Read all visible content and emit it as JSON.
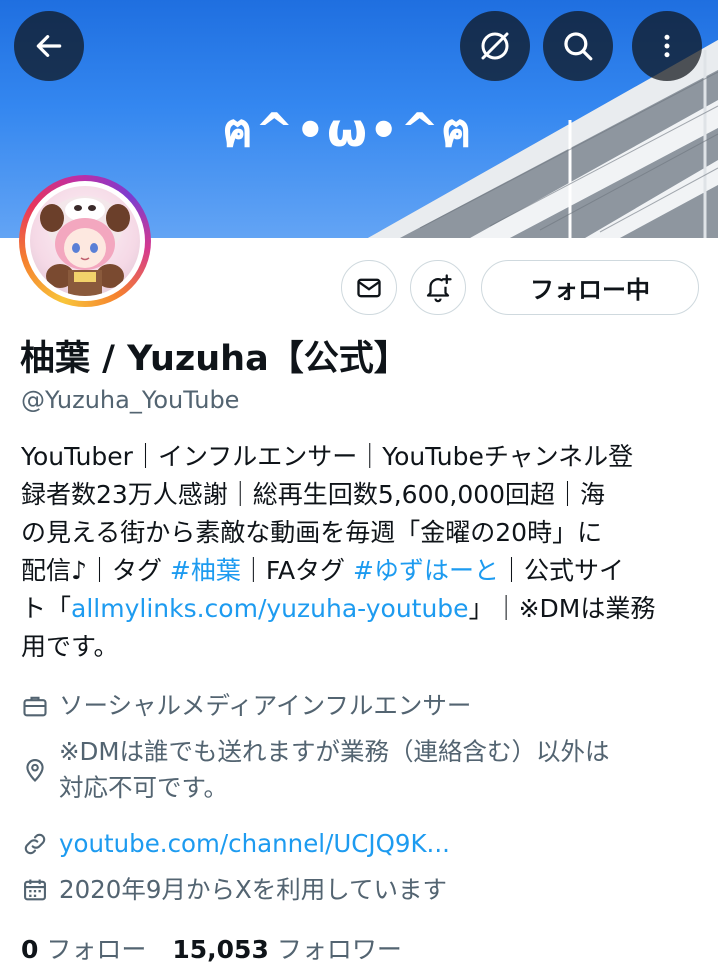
{
  "banner": {
    "text": "ฅ^•ω•^ฅ"
  },
  "header_buttons": {
    "back": "arrow-left-icon",
    "nosignal": "slash-circle-icon",
    "search": "search-icon",
    "more": "more-vertical-icon"
  },
  "actions": {
    "follow_label": "フォロー中"
  },
  "profile": {
    "display_name": "柚葉 / Yuzuha【公式】",
    "handle": "@Yuzuha_YouTube",
    "bio_lines": [
      "YouTuber｜インフルエンサー｜YouTubeチャンネル登",
      "録者数23万人感謝｜総再生回数5,600,000回超｜海",
      "の見える街から素敵な動画を毎週「金曜の20時」に"
    ],
    "bio_line4": {
      "pre": "配信♪｜タグ ",
      "tag1": "#柚葉",
      "mid": "｜FAタグ ",
      "tag2": "#ゆずはーと",
      "post": "｜公式サイ"
    },
    "bio_line5": {
      "pre": "ト「",
      "link": "allmylinks.com/yuzuha-youtube",
      "post": "」｜※DMは業務"
    },
    "bio_line6": "用です。",
    "category": "ソーシャルメディアインフルエンサー",
    "location_lines": [
      "※DMは誰でも送れますが業務（連絡含む）以外は",
      "対応不可です。"
    ],
    "website": "youtube.com/channel/UCJQ9K...",
    "joined": "2020年9月からXを利用しています"
  },
  "stats": {
    "following_count": "0",
    "following_label": "フォロー",
    "followers_count": "15,053",
    "followers_label": "フォロワー"
  },
  "colors": {
    "link": "#1d9bf0",
    "secondary_text": "#536471",
    "banner_sky": "#2f80ee"
  }
}
